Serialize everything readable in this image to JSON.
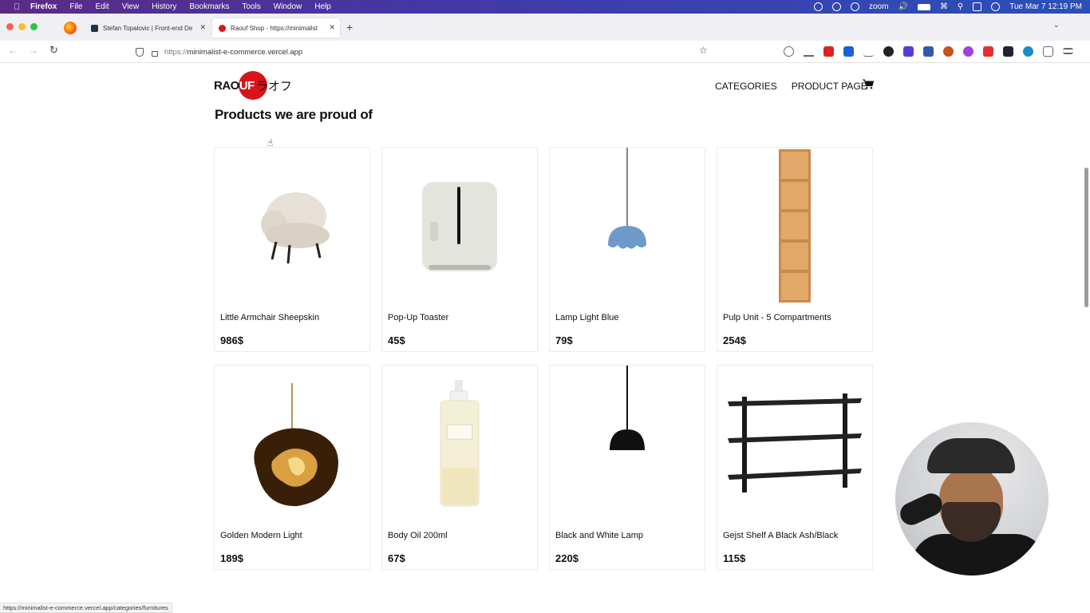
{
  "menubar": {
    "app": "Firefox",
    "items": [
      "File",
      "Edit",
      "View",
      "History",
      "Bookmarks",
      "Tools",
      "Window",
      "Help"
    ],
    "zoom_label": "zoom",
    "clock": "Tue Mar 7  12:19 PM"
  },
  "tabs": [
    {
      "title": "Stefan Topalovic | Front-end De"
    },
    {
      "title": "Raouf Shop - https://minimalist"
    }
  ],
  "navbar": {
    "url_protocol": "https://",
    "url_host": "minimalist-e-commerce.vercel.app"
  },
  "site": {
    "logo_start": "RAO",
    "logo_circle": "UF",
    "logo_jp": "ラオフ",
    "nav": [
      {
        "label": "CATEGORIES"
      },
      {
        "label": "PRODUCT PAGE"
      }
    ]
  },
  "section": {
    "title": "Products we are proud of"
  },
  "products": [
    {
      "name": "Little Armchair Sheepskin",
      "price": "986$",
      "icon": "armchair-image"
    },
    {
      "name": "Pop-Up Toaster",
      "price": "45$",
      "icon": "toaster-image"
    },
    {
      "name": "Lamp Light Blue",
      "price": "79$",
      "icon": "blue-lamp-image"
    },
    {
      "name": "Pulp Unit - 5 Compartments",
      "price": "254$",
      "icon": "shelf-unit-image"
    },
    {
      "name": "Golden Modern Light",
      "price": "189$",
      "icon": "golden-light-image"
    },
    {
      "name": "Body Oil 200ml",
      "price": "67$",
      "icon": "body-oil-image"
    },
    {
      "name": "Black and White Lamp",
      "price": "220$",
      "icon": "black-lamp-image"
    },
    {
      "name": "Gejst Shelf A Black Ash/Black",
      "price": "115$",
      "icon": "wall-shelf-image"
    }
  ],
  "status_bar": {
    "url": "https://minimalist-e-commerce.vercel.app/categories/furnitures"
  },
  "colors": {
    "brand_red": "#d7141a",
    "text": "#111111"
  }
}
